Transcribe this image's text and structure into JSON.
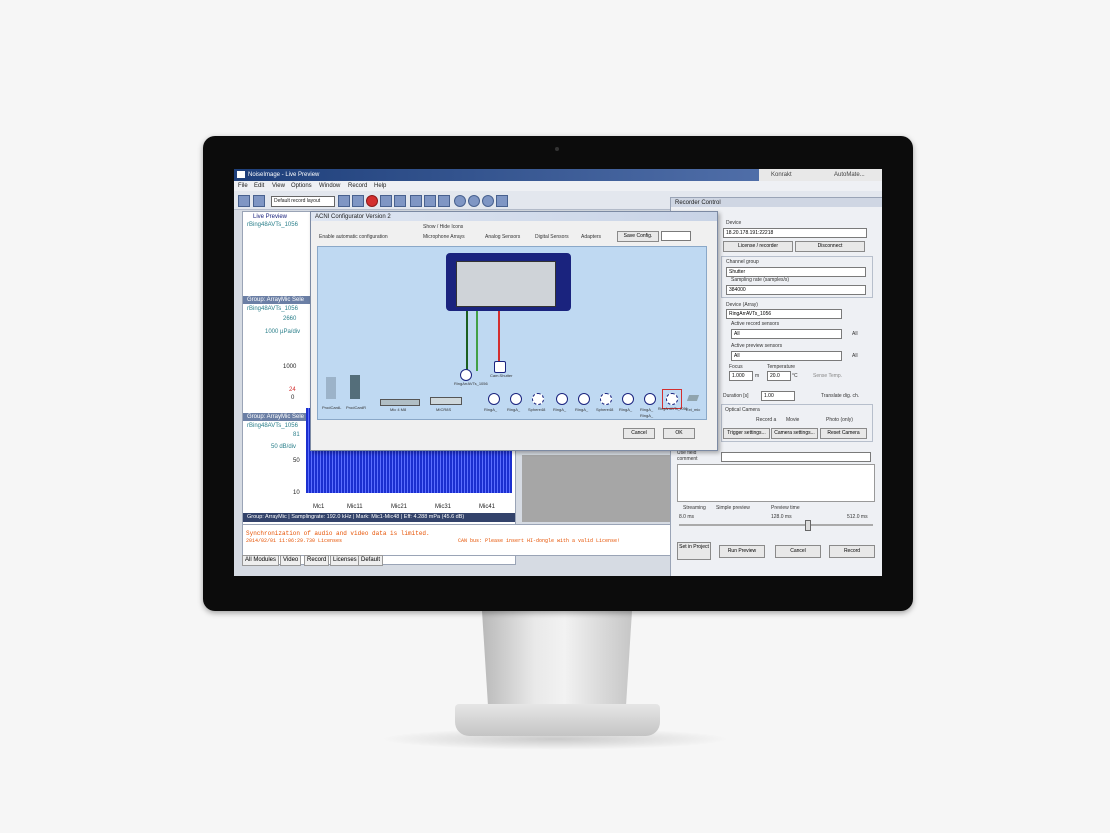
{
  "window": {
    "title": "NoiseImage - Live Preview",
    "user": "Konrakt",
    "user_right": "AutoMate..."
  },
  "menu": [
    "File",
    "Edit",
    "View",
    "Options",
    "Window",
    "Record",
    "Help"
  ],
  "toolbar": {
    "layout_select": "Default record layout"
  },
  "live_preview": {
    "label": "Live Preview",
    "panel1_title": "rBing48AVTs_1056",
    "group1": "Group: ArrayMic Sele",
    "panel2_title": "rBing48AVTs_1056",
    "y_top": "2660",
    "y_unit": "1000 µPa/div",
    "y_mid": "1000",
    "y_low": "24",
    "y_zero": "0",
    "group2": "Group: ArrayMic Sele",
    "panel3_title": "rBing48AVTs_1056",
    "db_top": "81",
    "db_unit": "50 dB/div",
    "db_mid": "50",
    "db_low": "10",
    "mic_labels": [
      "Mc1",
      "Mic11",
      "Mic21",
      "Mic31",
      "Mic41"
    ],
    "status_line": "Group: ArrayMic | Samplingrate: 192.0 kHz | Mark: Mic1-Mic48 | Eff: 4.288 mPa (45.6 dB)"
  },
  "log": {
    "line1": "Synchronization of audio and video data is limited.",
    "line2": "2014/02/01 11:06:29.730 Licenses",
    "line3": "CAN bus: Please insert HI-dongle with a valid License!"
  },
  "tabs": [
    "All Modules",
    "Video",
    "Record",
    "Licenses",
    "Default"
  ],
  "dialog": {
    "title": "ACNI Configurator Version 2",
    "show_hide": "Show / Hide Icons",
    "enable_auto": "Enable automatic configuration",
    "checks": [
      "Microphone Arrays",
      "Analog Sensors",
      "Digital Sensors",
      "Adapters"
    ],
    "save_button": "Save Config.",
    "cancel_button": "Cancel",
    "ok_button": "OK",
    "node_labels": [
      "RingArrAVTs_1056",
      "Cam.Shutter",
      "ProdCardL",
      "ProdCardR",
      "Mic 4 M8",
      "MICR8S",
      "RingA_",
      "RingA_",
      "Sphere48",
      "RingA_",
      "RingA_",
      "Sphere48",
      "RingA_",
      "RingA_",
      "RingA_",
      "RingArrAVTs_1056",
      "Ext_mic"
    ]
  },
  "recorder": {
    "title": "Recorder Control",
    "device_label": "Device",
    "ip": "18.20.178.191:22218",
    "connect_button": "License / recorder",
    "disconnect_button": "Disconnect",
    "channel_group_label": "Channel group",
    "channel_group": "Shutter",
    "sampling_label": "Sampling rate (samples/s)",
    "sampling": "384000",
    "device_array_label": "Device (Array)",
    "device_array": "RingArrAVTs_1056",
    "active_record_label": "Active record sensors",
    "active_record": "All",
    "active_preview_label": "Active preview sensors",
    "active_preview": "All",
    "all_label": "All",
    "focus_label": "Focus",
    "focus": "1.000",
    "focus_unit": "m",
    "temp_label": "Temperature",
    "temp": "20.0",
    "temp_unit": "°C",
    "sense_temp": "Sense Temp.",
    "duration_label": "Duration [s]",
    "duration": "1.00",
    "translate": "Translate dig. ch.",
    "optical_label": "Optical Camera",
    "record_a": "Record a",
    "movie": "Movie",
    "photo": "Photo (only)",
    "trigger_button": "Trigger settings...",
    "camera_button": "Camera settings...",
    "reset_button": "Reset Camera",
    "user_field_label": "Use field comment",
    "streaming": "Streaming",
    "simple_preview": "Simple preview",
    "preview_time": "Preview time",
    "t0": "8.0 ms",
    "t1": "128.0 ms",
    "t2": "512.0 ms",
    "set_project_button": "Set in Project",
    "run_preview_button": "Run Preview",
    "cancel_button": "Cancel",
    "record_button": "Record"
  },
  "colors": {
    "accent": "#1a237e",
    "diagram_bg": "#bfd9f2",
    "bars": "#1b2fcf",
    "log_text": "#e65100"
  }
}
